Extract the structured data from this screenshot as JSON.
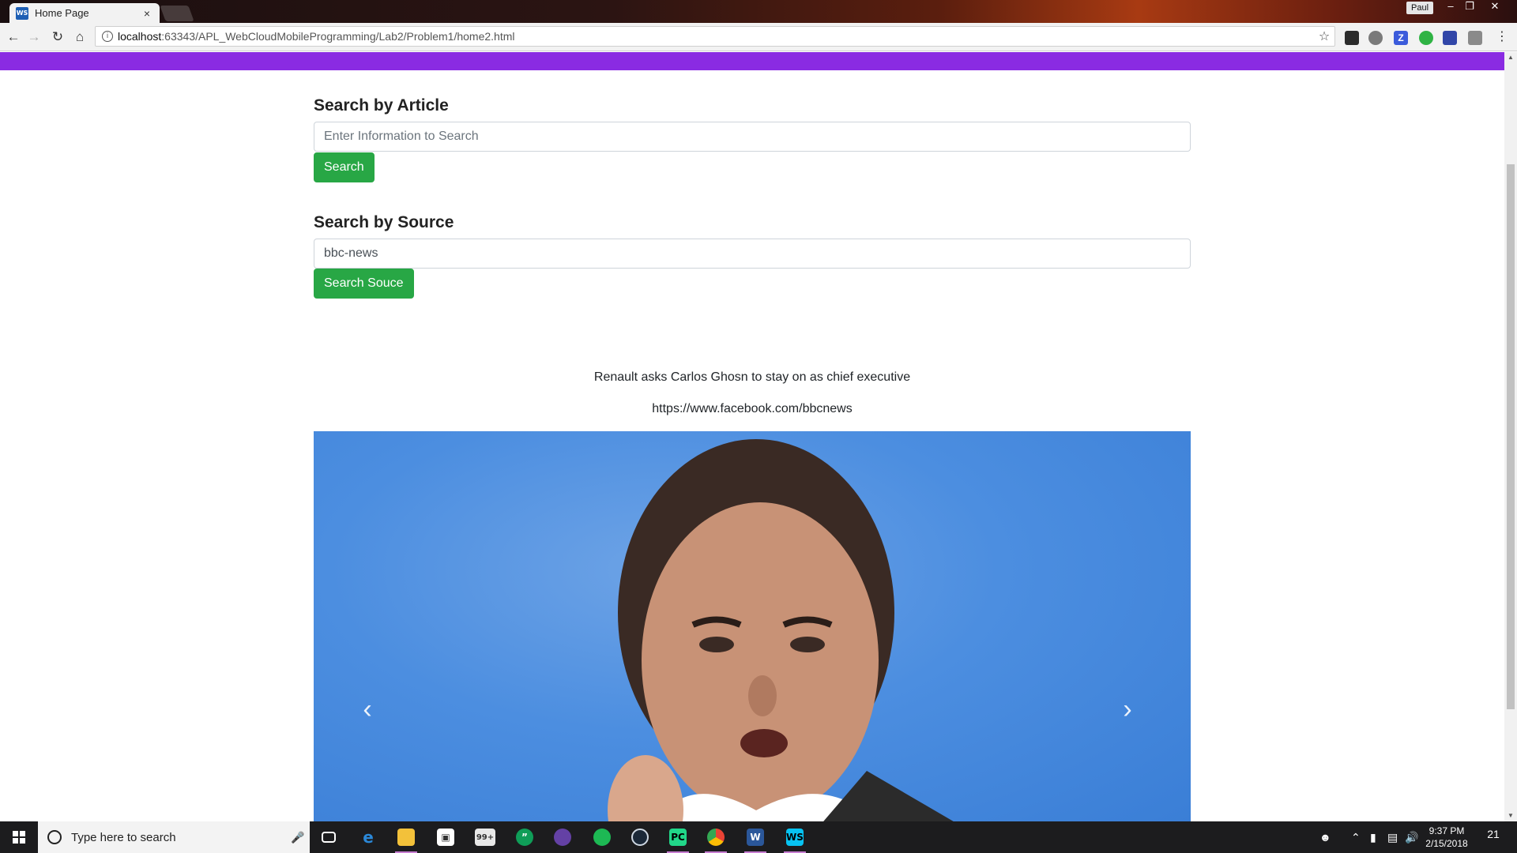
{
  "browser": {
    "tab_title": "Home Page",
    "tab_close": "×",
    "profile_name": "Paul",
    "url_host": "localhost",
    "url_path": ":63343/APL_WebCloudMobileProgramming/Lab2/Problem1/home2.html",
    "window_controls": {
      "minimize": "–",
      "restore": "❐",
      "close": "✕"
    }
  },
  "page": {
    "accent_bar_color": "#8a2be2",
    "article_search": {
      "title": "Search by Article",
      "placeholder": "Enter Information to Search",
      "value": "",
      "button_label": "Search"
    },
    "source_search": {
      "title": "Search by Source",
      "placeholder": "",
      "value": "bbc-news",
      "button_label": "Search Souce"
    },
    "article": {
      "headline": "Renault asks Carlos Ghosn to stay on as chief executive",
      "link": "https://www.facebook.com/bbcnews"
    },
    "carousel": {
      "prev_label": "‹",
      "next_label": "›"
    }
  },
  "taskbar": {
    "search_placeholder": "Type here to search",
    "mail_badge": "99+",
    "time": "9:37 PM",
    "date": "2/15/2018",
    "notification_count": "21",
    "icons": [
      "task-view-icon",
      "edge-icon",
      "file-explorer-icon",
      "store-icon",
      "mail-icon",
      "hangouts-icon",
      "twitch-icon",
      "spotify-icon",
      "steam-icon",
      "pycharm-icon",
      "chrome-icon",
      "word-icon",
      "webstorm-icon"
    ]
  }
}
